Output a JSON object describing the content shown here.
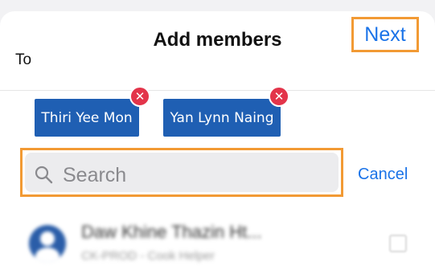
{
  "header": {
    "title": "Add members",
    "next_label": "Next"
  },
  "to_label": "To",
  "selected_members": [
    {
      "name": "Thiri Yee Mon",
      "remove_icon": "close-icon"
    },
    {
      "name": "Yan Lynn Naing",
      "remove_icon": "close-icon"
    }
  ],
  "search": {
    "placeholder": "Search",
    "icon": "search-icon",
    "cancel_label": "Cancel"
  },
  "contacts": [
    {
      "name": "Daw Khine Thazin Ht...",
      "subtitle": "CK-PROD - Cook Helper",
      "selected": false
    }
  ],
  "colors": {
    "accent": "#1a73e8",
    "chip": "#1f5fb3",
    "remove": "#e3344a",
    "highlight": "#f29a34"
  }
}
